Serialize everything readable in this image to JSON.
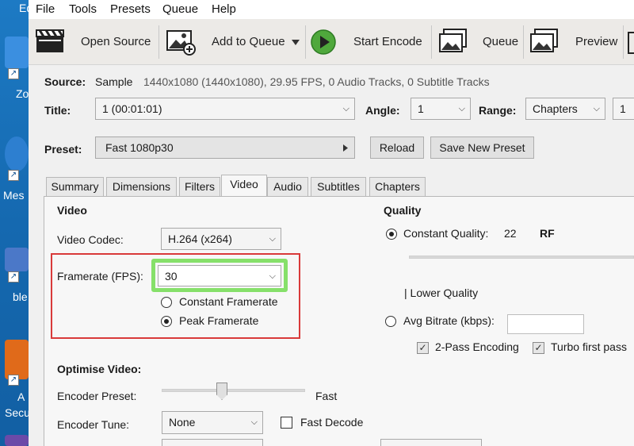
{
  "desktop": {
    "labels": [
      "Ed",
      "Zo",
      "Mes",
      "ble",
      "A",
      "Secu"
    ]
  },
  "menu": [
    "File",
    "Tools",
    "Presets",
    "Queue",
    "Help"
  ],
  "toolbar": {
    "open_source": "Open Source",
    "add_to_queue": "Add to Queue",
    "start_encode": "Start Encode",
    "queue": "Queue",
    "preview": "Preview"
  },
  "source": {
    "label": "Source:",
    "name": "Sample",
    "details": "1440x1080 (1440x1080), 29.95 FPS, 0 Audio Tracks, 0 Subtitle Tracks"
  },
  "title_row": {
    "title_label": "Title:",
    "title_value": "1 (00:01:01)",
    "angle_label": "Angle:",
    "angle_value": "1",
    "range_label": "Range:",
    "range_value": "Chapters",
    "range_start": "1"
  },
  "preset_row": {
    "label": "Preset:",
    "value": "Fast 1080p30",
    "reload": "Reload",
    "save_new": "Save New Preset"
  },
  "tabs": [
    {
      "label": "Summary",
      "active": false
    },
    {
      "label": "Dimensions",
      "active": false
    },
    {
      "label": "Filters",
      "active": false
    },
    {
      "label": "Video",
      "active": true
    },
    {
      "label": "Audio",
      "active": false
    },
    {
      "label": "Subtitles",
      "active": false
    },
    {
      "label": "Chapters",
      "active": false
    }
  ],
  "video": {
    "heading": "Video",
    "codec_label": "Video Codec:",
    "codec_value": "H.264 (x264)",
    "framerate_label": "Framerate (FPS):",
    "framerate_value": "30",
    "constant_framerate": "Constant Framerate",
    "peak_framerate": "Peak Framerate",
    "selected_mode": "Peak Framerate"
  },
  "quality": {
    "heading": "Quality",
    "constant_quality_label": "Constant Quality:",
    "constant_quality_value": "22",
    "constant_quality_unit": "RF",
    "lower_quality": "| Lower Quality",
    "avg_bitrate_label": "Avg Bitrate (kbps):",
    "two_pass": "2-Pass Encoding",
    "turbo": "Turbo first pass",
    "two_pass_checked": true,
    "turbo_checked": true
  },
  "optimise": {
    "heading": "Optimise Video:",
    "encoder_preset_label": "Encoder Preset:",
    "encoder_preset_value": "Fast",
    "encoder_preset_position": 0.42,
    "encoder_tune_label": "Encoder Tune:",
    "encoder_tune_value": "None",
    "fast_decode": "Fast Decode",
    "fast_decode_checked": false
  },
  "colors": {
    "highlight_red": "#d93a3a",
    "highlight_green": "#86e06a",
    "play_green": "#4fa83c"
  }
}
